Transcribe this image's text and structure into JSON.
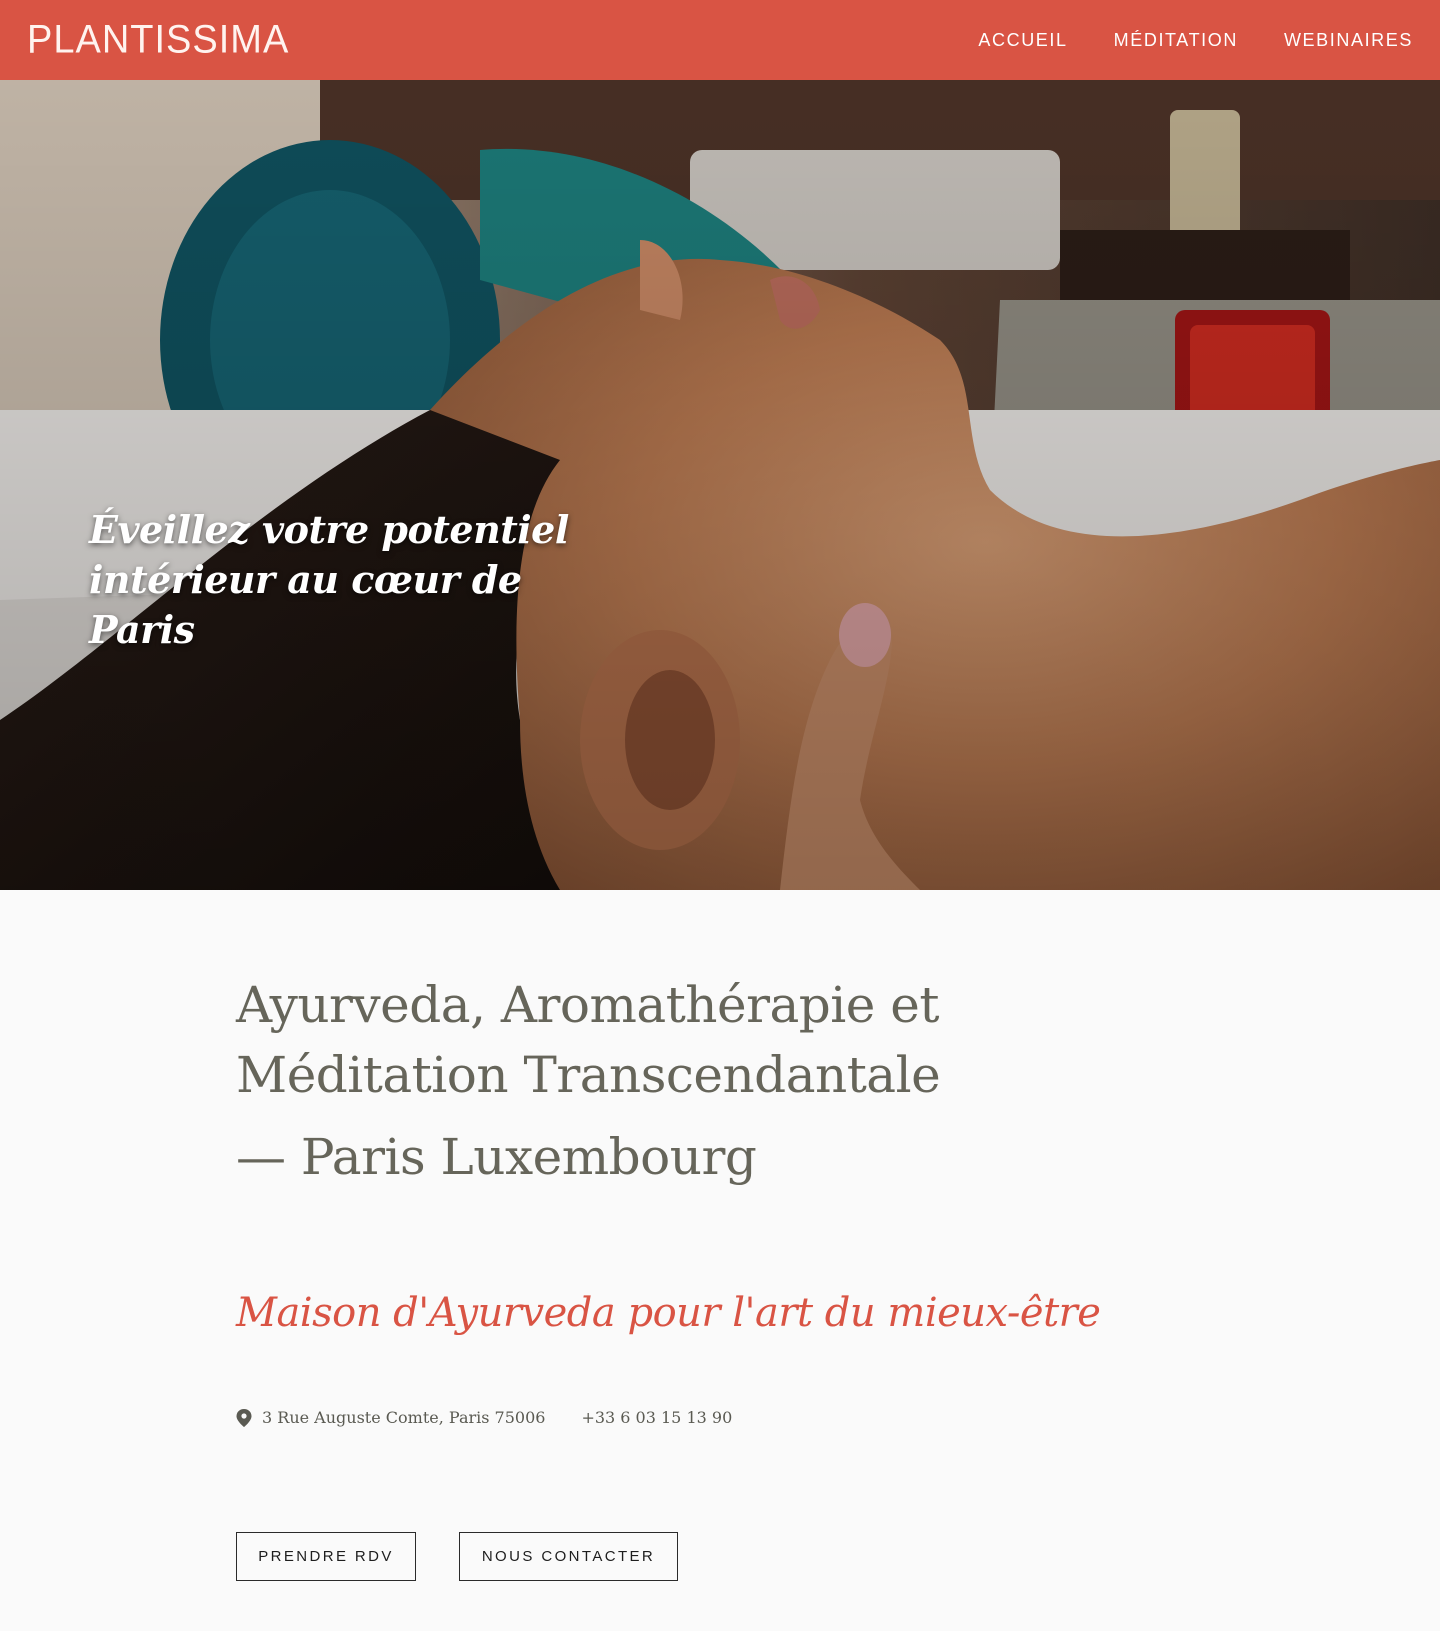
{
  "header": {
    "logo_text": "PLANTISSIMA",
    "nav": [
      {
        "label": "ACCUEIL"
      },
      {
        "label": "MÉDITATION"
      },
      {
        "label": "WEBINAIRES"
      }
    ]
  },
  "hero": {
    "headline_line1": "Éveillez votre potentiel",
    "headline_line2": "intérieur au cœur de Paris"
  },
  "main": {
    "title_line1": "Ayurveda, Aromathérapie et",
    "title_line2": "Méditation Transcendantale",
    "title_line3": "— Paris Luxembourg",
    "tagline": "Maison d'Ayurveda pour l'art du mieux-être",
    "address": "3 Rue Auguste Comte, Paris 75006",
    "phone": "+33 6 03 15 13 90",
    "buttons": {
      "book": "PRENDRE RDV",
      "contact": "NOUS CONTACTER"
    }
  },
  "colors": {
    "brand": "#d95444",
    "title_text": "#66655a",
    "background": "#fafafa"
  },
  "icons": {
    "address": "map-pin-icon"
  }
}
